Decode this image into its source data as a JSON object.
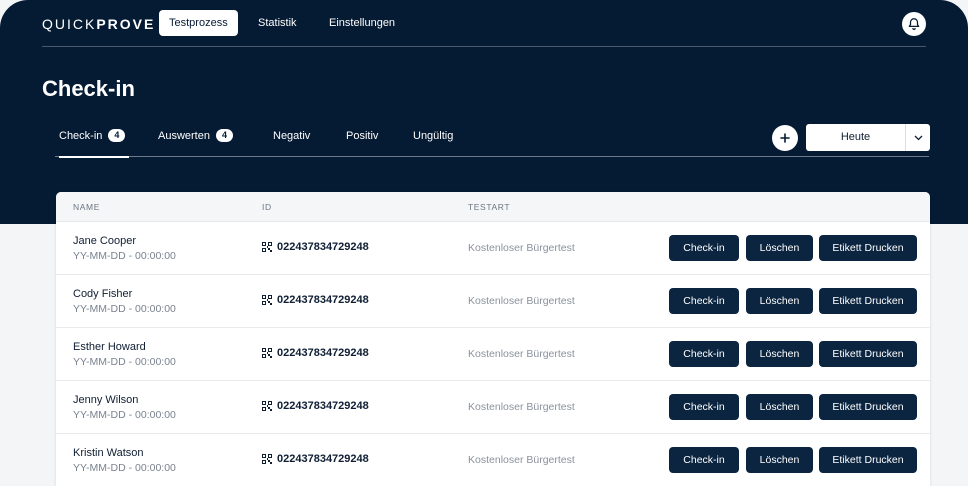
{
  "app": {
    "logo_light": "QUICK",
    "logo_bold": "PROVE"
  },
  "nav": [
    {
      "label": "Testprozess",
      "active": true
    },
    {
      "label": "Statistik",
      "active": false
    },
    {
      "label": "Einstellungen",
      "active": false
    }
  ],
  "icons": {
    "bell": "bell-icon",
    "add": "plus-icon",
    "dropdown": "chevron-down-icon",
    "qr": "qr-code-icon"
  },
  "page": {
    "title": "Check-in"
  },
  "tabs": [
    {
      "label": "Check-in",
      "count": "4",
      "active": true
    },
    {
      "label": "Auswerten",
      "count": "4",
      "active": false
    },
    {
      "label": "Negativ",
      "count": null,
      "active": false
    },
    {
      "label": "Positiv",
      "count": null,
      "active": false
    },
    {
      "label": "Ungültig",
      "count": null,
      "active": false
    }
  ],
  "filter": {
    "date_value": "Heute"
  },
  "table": {
    "columns": [
      "NAME",
      "ID",
      "TESTART"
    ],
    "actions": {
      "checkin": "Check-in",
      "delete": "Löschen",
      "print": "Etikett Drucken"
    },
    "rows": [
      {
        "name": "Jane Cooper",
        "date": "YY-MM-DD - 00:00:00",
        "id": "022437834729248",
        "type": "Kostenloser Bürgertest"
      },
      {
        "name": "Cody Fisher",
        "date": "YY-MM-DD - 00:00:00",
        "id": "022437834729248",
        "type": "Kostenloser Bürgertest"
      },
      {
        "name": "Esther Howard",
        "date": "YY-MM-DD - 00:00:00",
        "id": "022437834729248",
        "type": "Kostenloser Bürgertest"
      },
      {
        "name": "Jenny Wilson",
        "date": "YY-MM-DD - 00:00:00",
        "id": "022437834729248",
        "type": "Kostenloser Bürgertest"
      },
      {
        "name": "Kristin Watson",
        "date": "YY-MM-DD - 00:00:00",
        "id": "022437834729248",
        "type": "Kostenloser Bürgertest"
      }
    ]
  },
  "colors": {
    "header_bg": "#051a33",
    "button_bg": "#0b2540",
    "page_bg": "#f4f5f7"
  }
}
